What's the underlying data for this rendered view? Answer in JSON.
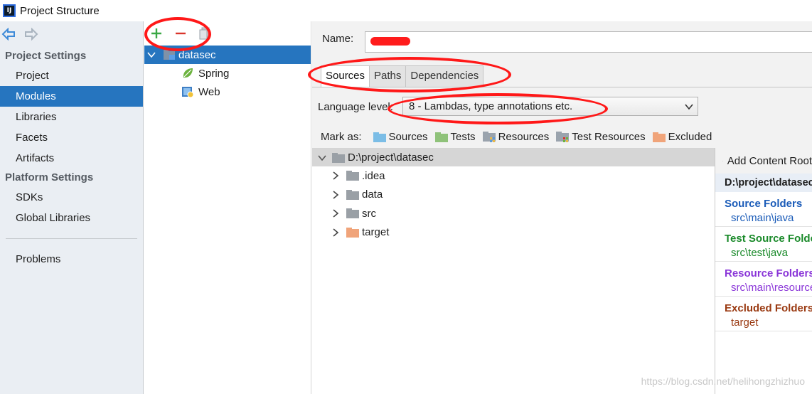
{
  "window": {
    "title": "Project Structure",
    "logo_text": "IJ"
  },
  "left_panel": {
    "sections": [
      {
        "heading": "Project Settings",
        "items": [
          "Project",
          "Modules",
          "Libraries",
          "Facets",
          "Artifacts"
        ]
      },
      {
        "heading": "Platform Settings",
        "items": [
          "SDKs",
          "Global Libraries"
        ]
      }
    ],
    "selected": "Modules",
    "bottom_item": "Problems"
  },
  "module_tree": {
    "root": "datasec",
    "children": [
      "Spring",
      "Web"
    ]
  },
  "main": {
    "name_label": "Name:",
    "name_value": "",
    "tabs": [
      "Sources",
      "Paths",
      "Dependencies"
    ],
    "active_tab": "Sources",
    "language_level_label": "Language level:",
    "language_level_value": "8 - Lambdas, type annotations etc.",
    "mark_as_label": "Mark as:",
    "mark_as": [
      {
        "label": "Sources",
        "color": "#7bbde6"
      },
      {
        "label": "Tests",
        "color": "#8fc27a"
      },
      {
        "label": "Resources",
        "color": "#9aa3ad"
      },
      {
        "label": "Test Resources",
        "color": "#9aa3ad"
      },
      {
        "label": "Excluded",
        "color": "#f0a47a"
      }
    ],
    "dir_tree": {
      "root": "D:\\project\\datasec",
      "children": [
        {
          "name": ".idea",
          "color": "#9aa0a6"
        },
        {
          "name": "data",
          "color": "#9aa0a6"
        },
        {
          "name": "src",
          "color": "#9aa0a6"
        },
        {
          "name": "target",
          "color": "#f0a47a"
        }
      ]
    },
    "content_root": {
      "add_label": "Add Content Root",
      "path": "D:\\project\\datasec",
      "groups": [
        {
          "title": "Source Folders",
          "path": "src\\main\\java",
          "color": "#1a5bb8"
        },
        {
          "title": "Test Source Folders",
          "path": "src\\test\\java",
          "color": "#1a8a2a"
        },
        {
          "title": "Resource Folders",
          "path": "src\\main\\resources",
          "color": "#8a36d8"
        },
        {
          "title": "Excluded Folders",
          "path": "target",
          "color": "#9a3a12"
        }
      ]
    }
  },
  "watermark": "https://blog.csdn.net/helihongzhizhuo",
  "colors": {
    "selection": "#2675bf",
    "annotation": "#ff1818"
  }
}
